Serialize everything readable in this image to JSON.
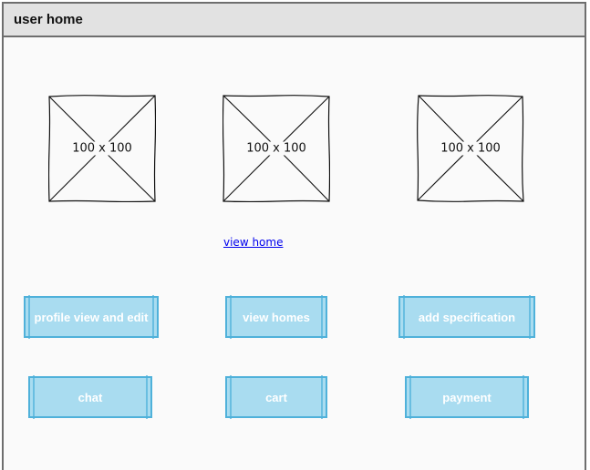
{
  "window": {
    "title": "user home"
  },
  "images": [
    {
      "label": "100 x 100"
    },
    {
      "label": "100 x 100"
    },
    {
      "label": "100 x 100"
    }
  ],
  "link": {
    "label": "view home"
  },
  "buttons": {
    "profile": "profile view and edit",
    "view_homes": "view homes",
    "add_spec": "add specification",
    "chat": "chat",
    "cart": "cart",
    "payment": "payment"
  },
  "colors": {
    "button_fill": "#a9dcf0",
    "button_border": "#4fb1da",
    "link": "#0000ee",
    "titlebar": "#e2e2e2"
  }
}
